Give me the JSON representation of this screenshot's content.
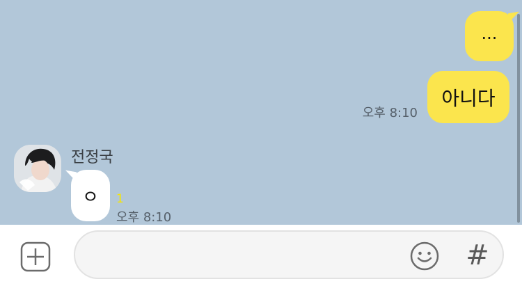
{
  "messages_out": [
    {
      "text": "..."
    },
    {
      "text": "아니다",
      "time": "오후 8:10"
    }
  ],
  "message_in": {
    "sender": "전정국",
    "text": "ㅇ",
    "unread_count": "1",
    "time": "오후 8:10"
  },
  "input": {
    "value": "",
    "placeholder": ""
  },
  "icons": {
    "attach": "plus-square-icon",
    "emoji": "emoji-smile-icon",
    "hashtag": "hashtag-icon"
  },
  "colors": {
    "chat_background": "#b2c7d9",
    "outgoing_bubble": "#fbe54d",
    "incoming_bubble": "#ffffff",
    "unread": "#f7e600"
  }
}
